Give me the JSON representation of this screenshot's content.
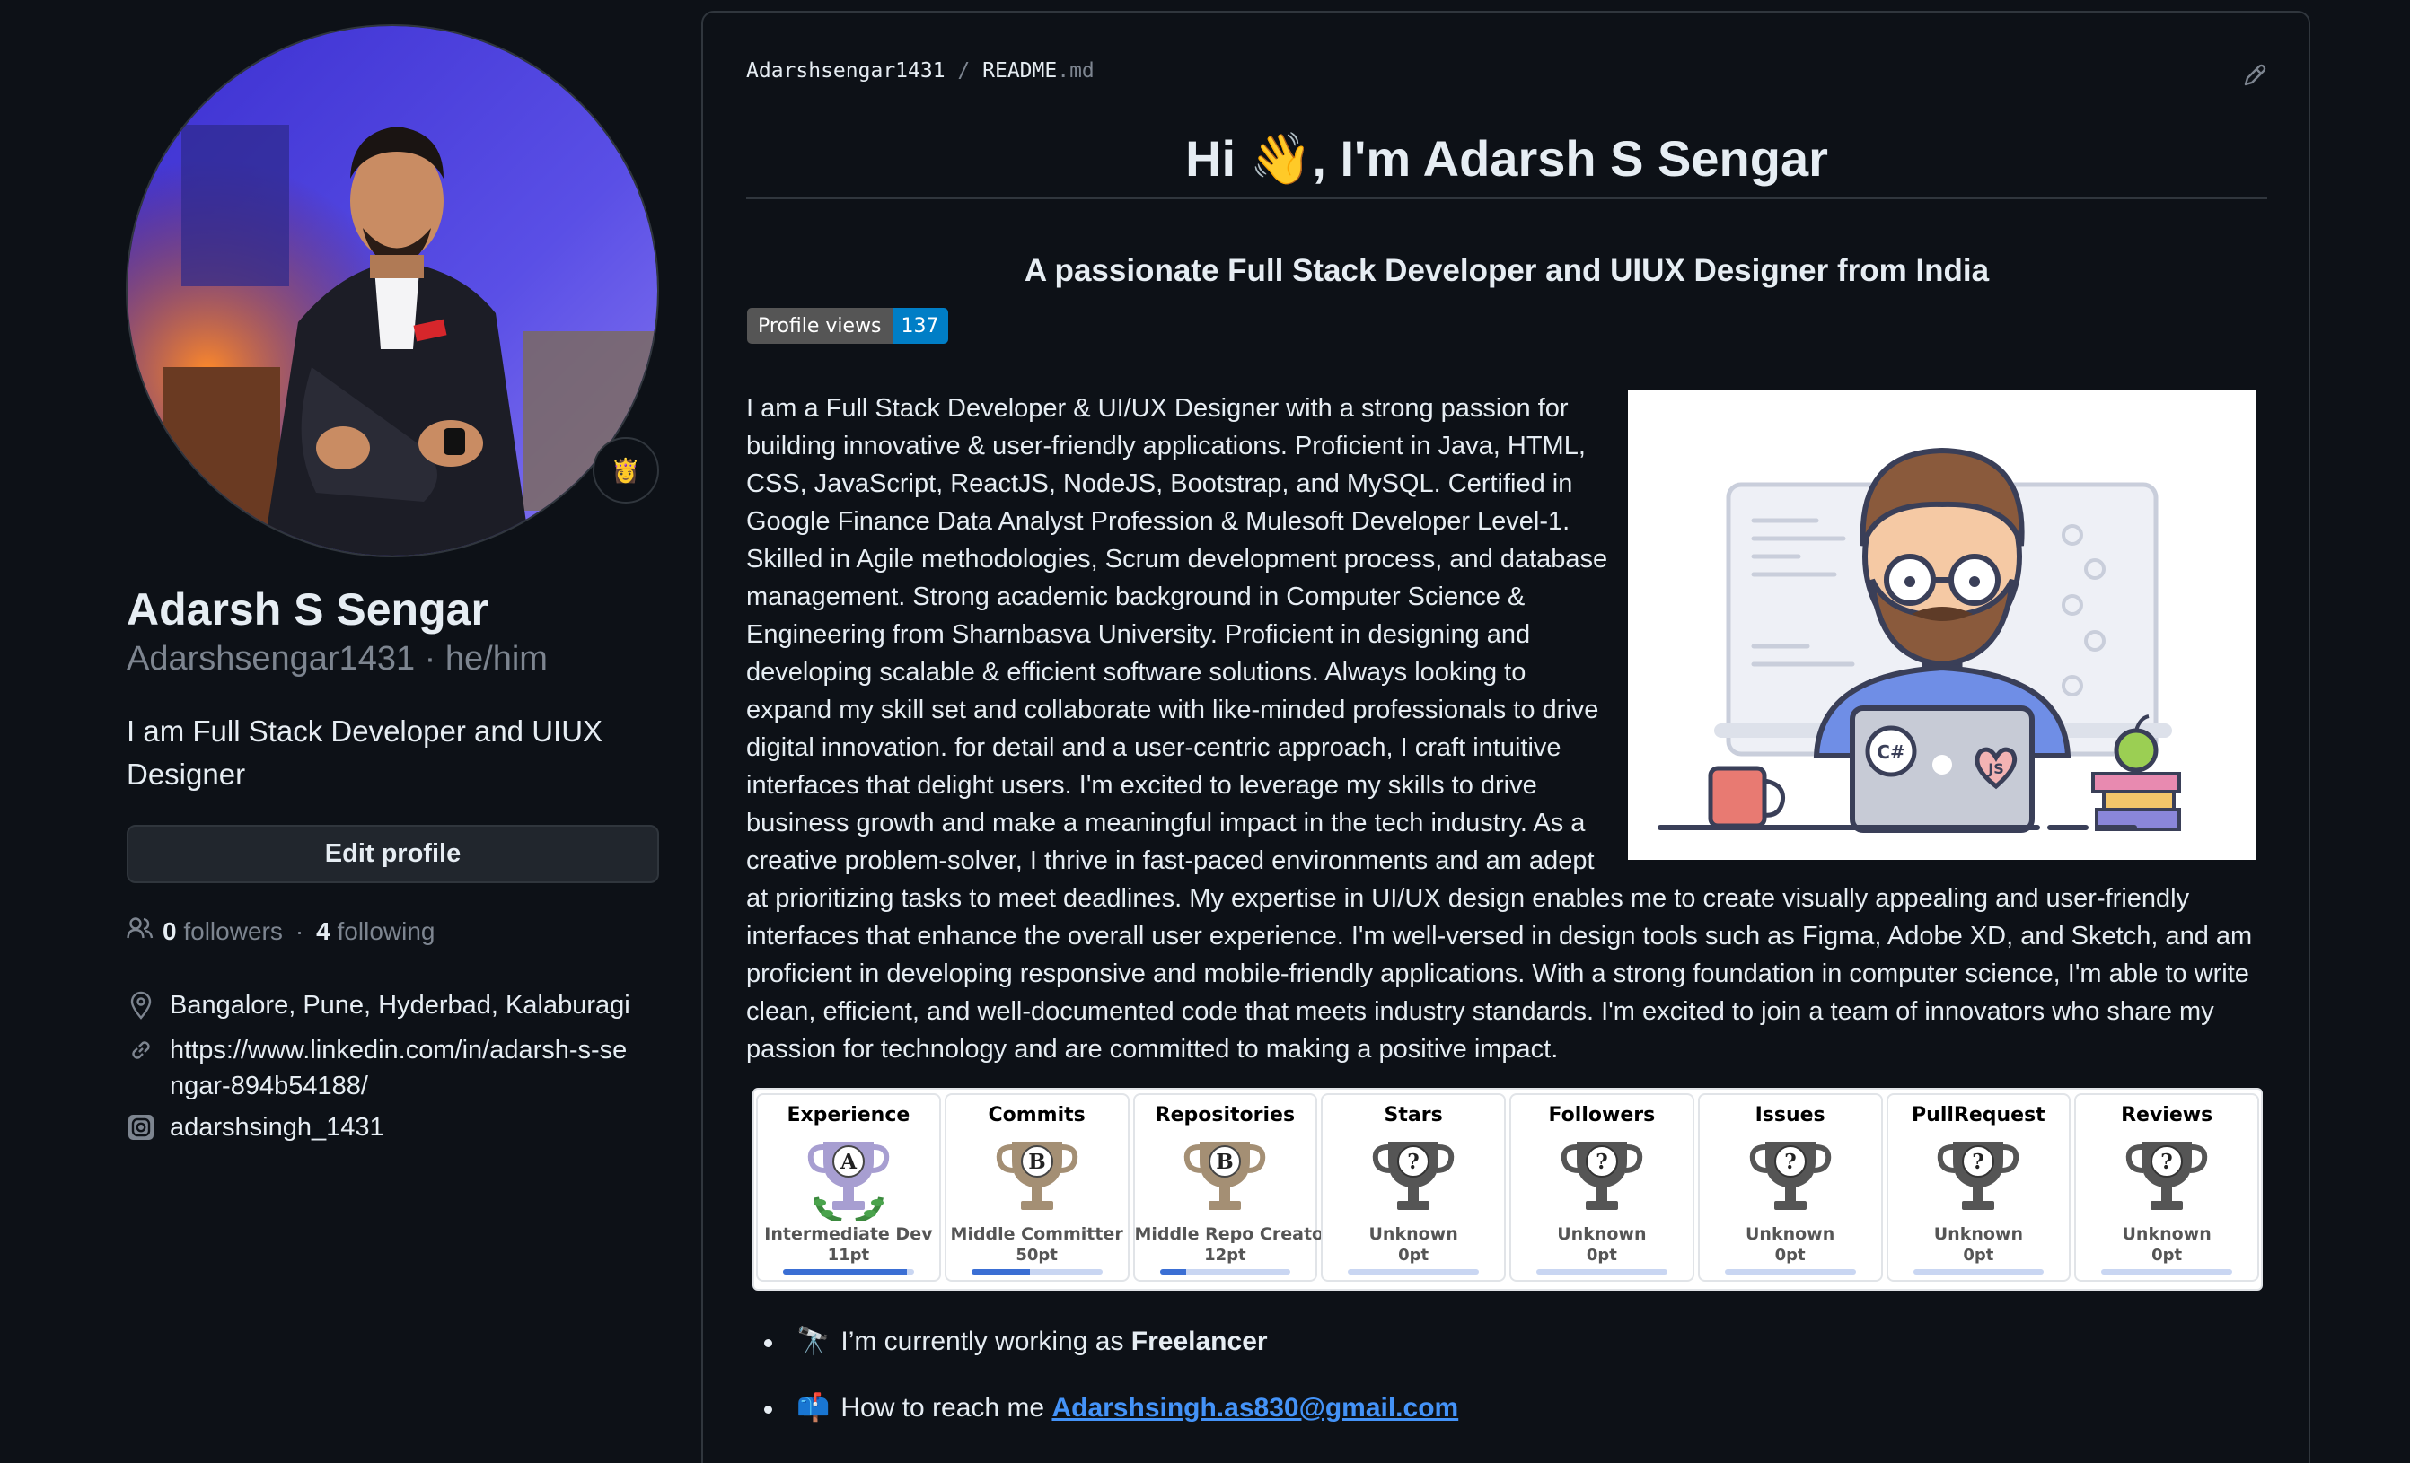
{
  "profile": {
    "avatar_alt": "Adarsh S Sengar",
    "status_emoji": "👸",
    "name": "Adarsh S Sengar",
    "login_pronouns": "Adarshsengar1431 · he/him",
    "bio": "I am Full Stack Developer and UIUX Designer",
    "edit_button": "Edit profile",
    "followers_count": "0",
    "followers_label": "followers",
    "following_count": "4",
    "following_label": "following",
    "location": "Bangalore, Pune, Hyderbad, Kalaburagi",
    "website": "https://www.linkedin.com/in/adarsh-s-sengar-894b54188/",
    "instagram": "adarshsingh_1431",
    "icons": {
      "followers": "people-icon",
      "location": "location-pin-icon",
      "website": "link-icon",
      "instagram": "instagram-icon"
    }
  },
  "readme": {
    "crumb_owner": "Adarshsengar1431",
    "crumb_sep": "/",
    "crumb_file": "README",
    "crumb_ext": ".md",
    "edit_icon": "pencil-icon",
    "title": "Hi 👋, I'm Adarsh S Sengar",
    "subtitle": "A passionate Full Stack Developer and UIUX Designer from India",
    "badge_label": "Profile views",
    "badge_value": "137",
    "about": "I am a Full Stack Developer & UI/UX Designer with a strong passion for building innovative & user-friendly applications. Proficient in Java, HTML, CSS, JavaScript, ReactJS, NodeJS, Bootstrap, and MySQL. Certified in Google Finance Data Analyst Profession & Mulesoft Developer Level-1. Skilled in Agile methodologies, Scrum development process, and database management. Strong academic background in Computer Science & Engineering from Sharnbasva University. Proficient in designing and developing scalable & efficient software solutions. Always looking to expand my skill set and collaborate with like-minded professionals to drive digital innovation. for detail and a user-centric approach, I craft intuitive interfaces that delight users. I'm excited to leverage my skills to drive business growth and make a meaningful impact in the tech industry. As a creative problem-solver, I thrive in fast-paced environments and am adept at prioritizing tasks to meet deadlines. My expertise in UI/UX design enables me to create visually appealing and user-friendly interfaces that enhance the overall user experience. I'm well-versed in design tools such as Figma, Adobe XD, and Sketch, and am proficient in developing responsive and mobile-friendly applications. With a strong foundation in computer science, I'm able to write clean, efficient, and well-documented code that meets industry standards. I'm excited to join a team of innovators who share my passion for technology and are committed to making a positive impact.",
    "illustration_labels": {
      "mug_tag": "C#",
      "sticker": "JS"
    },
    "trophies": [
      {
        "title": "Experience",
        "rank": "A",
        "name": "Intermediate Dev",
        "points": "11pt",
        "progress": 0.95,
        "color": "#a79ed1"
      },
      {
        "title": "Commits",
        "rank": "B",
        "name": "Middle Committer",
        "points": "50pt",
        "progress": 0.45,
        "color": "#a48f74"
      },
      {
        "title": "Repositories",
        "rank": "B",
        "name": "Middle Repo Creator",
        "points": "12pt",
        "progress": 0.2,
        "color": "#a48f74"
      },
      {
        "title": "Stars",
        "rank": "?",
        "name": "Unknown",
        "points": "0pt",
        "progress": 0,
        "color": "#555555"
      },
      {
        "title": "Followers",
        "rank": "?",
        "name": "Unknown",
        "points": "0pt",
        "progress": 0,
        "color": "#555555"
      },
      {
        "title": "Issues",
        "rank": "?",
        "name": "Unknown",
        "points": "0pt",
        "progress": 0,
        "color": "#555555"
      },
      {
        "title": "PullRequest",
        "rank": "?",
        "name": "Unknown",
        "points": "0pt",
        "progress": 0,
        "color": "#555555"
      },
      {
        "title": "Reviews",
        "rank": "?",
        "name": "Unknown",
        "points": "0pt",
        "progress": 0,
        "color": "#555555"
      }
    ],
    "bullets": [
      {
        "emoji": "🔭",
        "text": "I’m currently working as ",
        "bold": "Freelancer"
      },
      {
        "emoji": "📫",
        "text": "How to reach me ",
        "link": "Adarshsingh.as830@gmail.com"
      }
    ]
  }
}
